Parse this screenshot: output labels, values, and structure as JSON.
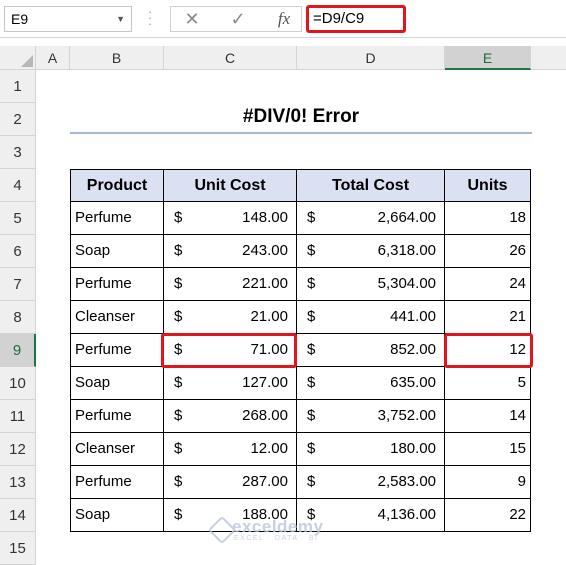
{
  "name_box": "E9",
  "formula": "=D9/C9",
  "formula_icons": {
    "cancel": "✕",
    "enter": "✓",
    "function": "fx"
  },
  "columns": [
    "A",
    "B",
    "C",
    "D",
    "E"
  ],
  "rows": [
    "1",
    "2",
    "3",
    "4",
    "5",
    "6",
    "7",
    "8",
    "9",
    "10",
    "11",
    "12",
    "13",
    "14",
    "15"
  ],
  "title": "#DIV/0! Error",
  "table": {
    "headers": [
      "Product",
      "Unit Cost",
      "Total Cost",
      "Units"
    ],
    "currency": "$",
    "rows": [
      {
        "product": "Perfume",
        "unit_cost": "148.00",
        "total_cost": "2,664.00",
        "units": "18"
      },
      {
        "product": "Soap",
        "unit_cost": "243.00",
        "total_cost": "6,318.00",
        "units": "26"
      },
      {
        "product": "Perfume",
        "unit_cost": "221.00",
        "total_cost": "5,304.00",
        "units": "24"
      },
      {
        "product": "Cleanser",
        "unit_cost": "21.00",
        "total_cost": "441.00",
        "units": "21"
      },
      {
        "product": "Perfume",
        "unit_cost": "71.00",
        "total_cost": "852.00",
        "units": "12"
      },
      {
        "product": "Soap",
        "unit_cost": "127.00",
        "total_cost": "635.00",
        "units": "5"
      },
      {
        "product": "Perfume",
        "unit_cost": "268.00",
        "total_cost": "3,752.00",
        "units": "14"
      },
      {
        "product": "Cleanser",
        "unit_cost": "12.00",
        "total_cost": "180.00",
        "units": "15"
      },
      {
        "product": "Perfume",
        "unit_cost": "287.00",
        "total_cost": "2,583.00",
        "units": "9"
      },
      {
        "product": "Soap",
        "unit_cost": "188.00",
        "total_cost": "4,136.00",
        "units": "22"
      }
    ]
  },
  "watermark": {
    "name": "exceldemy",
    "tagline": "EXCEL · DATA · BI"
  },
  "colors": {
    "highlight": "#e2141c",
    "header_fill": "#d9e1f2",
    "selection": "#217346"
  }
}
